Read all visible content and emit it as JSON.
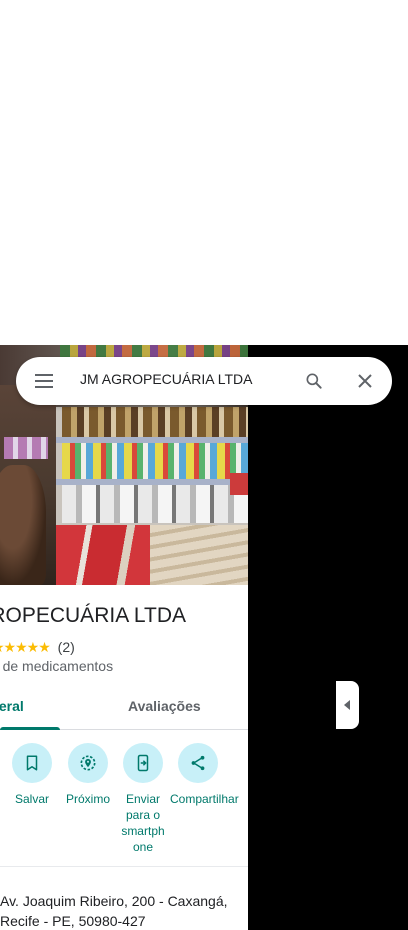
{
  "search": {
    "query": "JM AGROPECUÁRIA LTDA",
    "menu_icon": "menu-icon",
    "search_icon": "search-icon",
    "close_icon": "close-icon"
  },
  "place": {
    "title": "AGROPECUÁRIA LTDA",
    "stars": "★★★★★",
    "rating_count": "(2)",
    "category": "sta de medicamentos",
    "address": "Av. Joaquim Ribeiro, 200 - Caxangá, Recife - PE, 50980-427"
  },
  "tabs": [
    {
      "label": "io geral",
      "active": true
    },
    {
      "label": "Avaliações",
      "active": false
    }
  ],
  "actions": [
    {
      "label": "Salvar",
      "icon": "bookmark-icon"
    },
    {
      "label": "Próximo",
      "icon": "nearby-icon"
    },
    {
      "label": "Enviar para o smartph one",
      "icon": "send-to-phone-icon"
    },
    {
      "label": "Compartilhar",
      "icon": "share-icon"
    }
  ],
  "colors": {
    "accent": "#00796b",
    "action_bg": "#c8f0f8",
    "star": "#fbbc04"
  }
}
